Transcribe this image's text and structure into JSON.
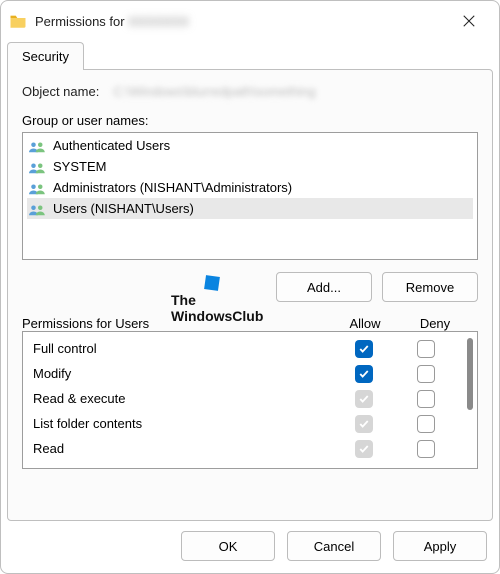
{
  "title": "Permissions for",
  "title_blurred": "XXXXXXX",
  "tab_security": "Security",
  "object_name_label": "Object name:",
  "object_name_value": "C:\\Windows\\blurredpath\\something",
  "group_label": "Group or user names:",
  "principals": {
    "0": "Authenticated Users",
    "1": "SYSTEM",
    "2": "Administrators (NISHANT\\Administrators)",
    "3": "Users (NISHANT\\Users)"
  },
  "add_btn": "Add...",
  "remove_btn": "Remove",
  "perm_header_label": "Permissions for Users",
  "allow_col": "Allow",
  "deny_col": "Deny",
  "perms": {
    "0": "Full control",
    "1": "Modify",
    "2": "Read & execute",
    "3": "List folder contents",
    "4": "Read"
  },
  "ok_btn": "OK",
  "cancel_btn": "Cancel",
  "apply_btn": "Apply",
  "watermark_line1": "The",
  "watermark_line2": "WindowsClub"
}
